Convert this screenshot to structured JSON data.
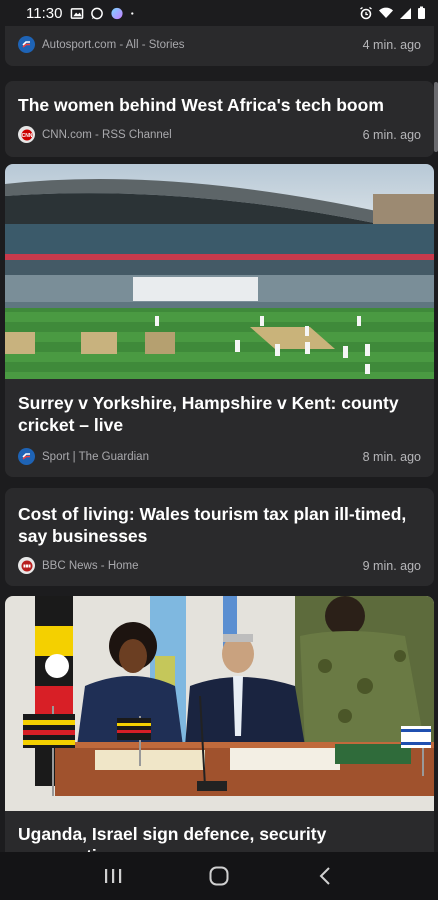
{
  "status_bar": {
    "time": "11:30",
    "left_icons": [
      "gallery-icon",
      "whatsapp-icon",
      "assistant-icon",
      "dot-icon"
    ],
    "right_icons": [
      "alarm-icon",
      "wifi-icon",
      "signal-icon",
      "battery-icon"
    ]
  },
  "feed": {
    "items": [
      {
        "title": "",
        "source": "Autosport.com - All - Stories",
        "time": "4 min. ago",
        "source_icon": "guardian-sport-icon"
      },
      {
        "title": "The women behind West Africa's tech boom",
        "source": "CNN.com - RSS Channel",
        "time": "6 min. ago",
        "source_icon": "cnn-icon"
      },
      {
        "title": "Surrey v Yorkshire, Hampshire v Kent: county cricket – live",
        "source": "Sport | The Guardian",
        "time": "8 min. ago",
        "source_icon": "guardian-sport-icon",
        "image": "cricket-stadium-image"
      },
      {
        "title": "Cost of living: Wales tourism tax plan ill-timed, say businesses",
        "source": "BBC News - Home",
        "time": "9 min. ago",
        "source_icon": "bbc-icon"
      },
      {
        "title": "Uganda, Israel sign defence, security cooperation",
        "image": "signing-ceremony-image"
      }
    ]
  },
  "nav_bar": {
    "buttons": [
      "recents-icon",
      "home-icon",
      "back-icon"
    ]
  },
  "colors": {
    "background": "#1c1c1e",
    "card": "#2a2a2c",
    "meta_text": "#a9a9ad",
    "guardian_icon": "#1e63b5"
  }
}
